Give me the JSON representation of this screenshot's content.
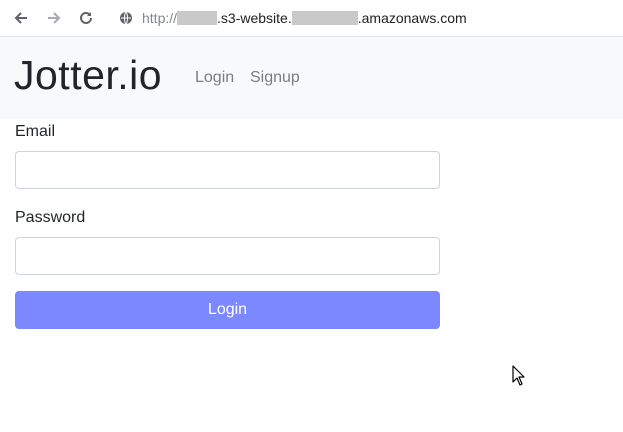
{
  "browser": {
    "back_icon": "arrow-left-icon",
    "forward_icon": "arrow-right-icon",
    "reload_icon": "reload-icon",
    "site_info_icon": "globe-icon",
    "url": {
      "scheme": "http://",
      "middle": ".s3-website.",
      "suffix": ".amazonaws.com"
    }
  },
  "navbar": {
    "brand": "Jotter.io",
    "links": [
      "Login",
      "Signup"
    ]
  },
  "form": {
    "email_label": "Email",
    "email_value": "",
    "password_label": "Password",
    "password_value": "",
    "submit_label": "Login"
  },
  "colors": {
    "primary_button": "#7b88ff",
    "navbar_bg": "#f8f9fa"
  }
}
